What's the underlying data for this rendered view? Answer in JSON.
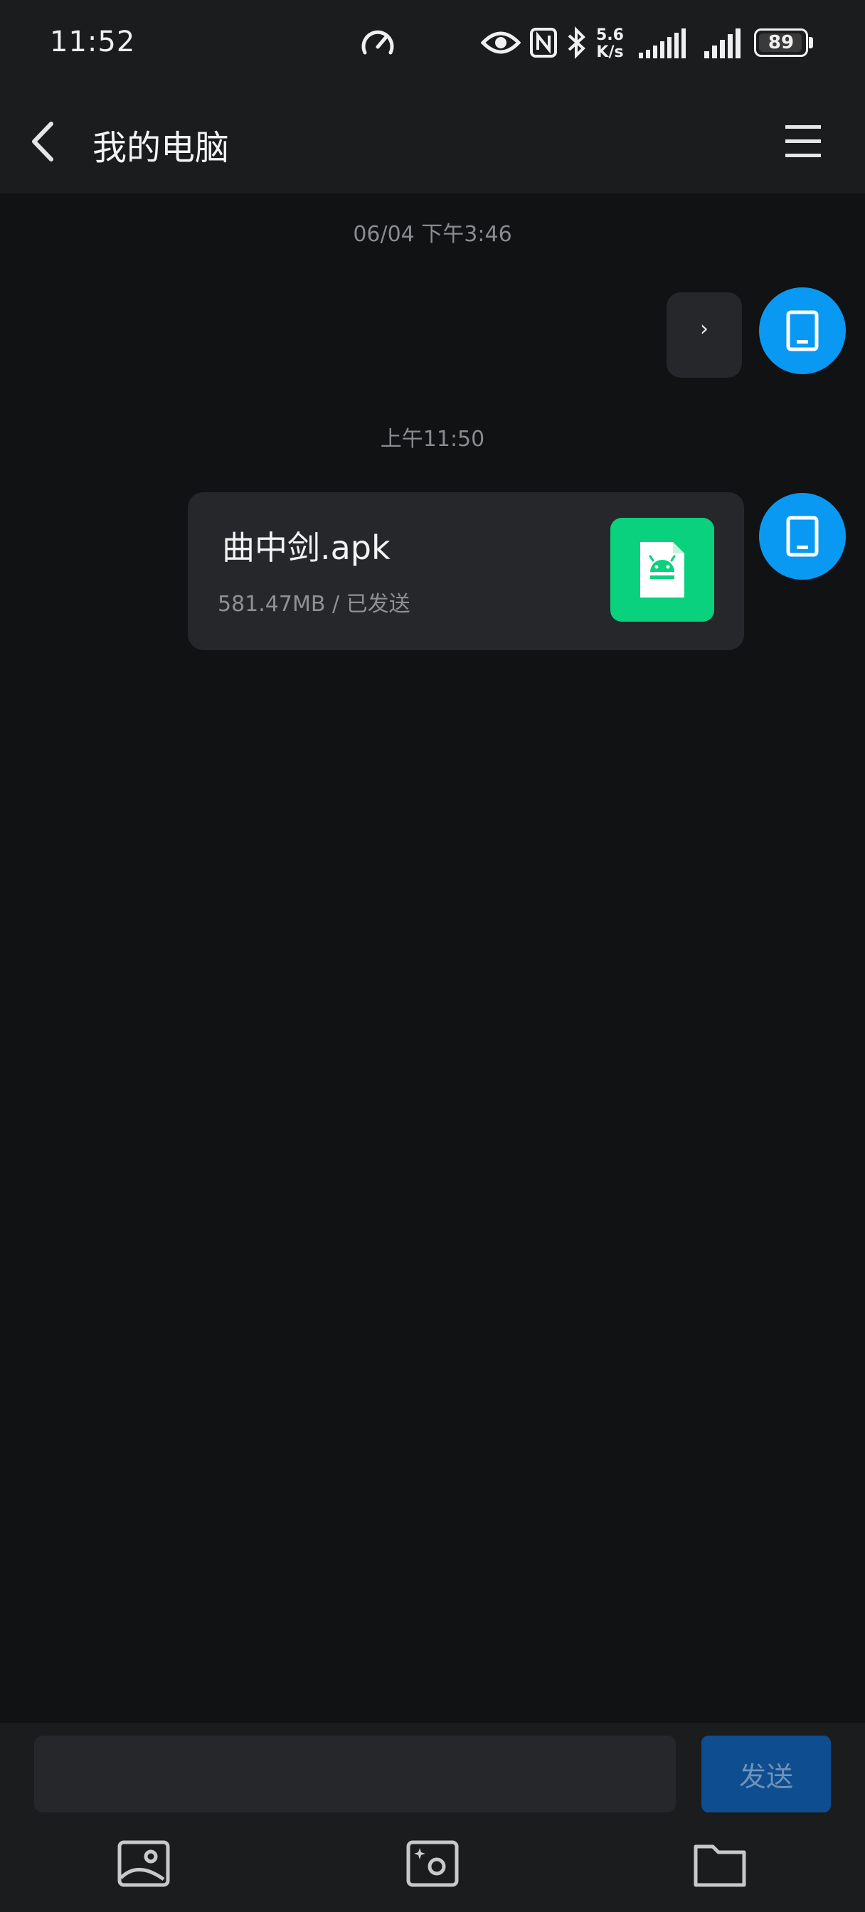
{
  "status_bar": {
    "time": "11:52",
    "net_speed_value": "5.6",
    "net_speed_unit": "K/s",
    "battery": "89"
  },
  "header": {
    "title": "我的电脑"
  },
  "messages": [
    {
      "type": "timestamp",
      "text": "06/04 下午3:46"
    },
    {
      "type": "text",
      "text": "›"
    },
    {
      "type": "timestamp",
      "text": "上午11:50"
    },
    {
      "type": "file",
      "file_name": "曲中剑.apk",
      "file_meta": "581.47MB / 已发送"
    }
  ],
  "composer": {
    "input_value": "",
    "send_label": "发送"
  },
  "icons": {
    "avatar": "phone-icon",
    "file": "android-apk-icon",
    "toolbar": [
      "image-icon",
      "camera-icon",
      "folder-icon"
    ]
  },
  "colors": {
    "accent": "#0a99f2",
    "apk_green": "#09d17d",
    "send_button": "#0e4d8f"
  }
}
